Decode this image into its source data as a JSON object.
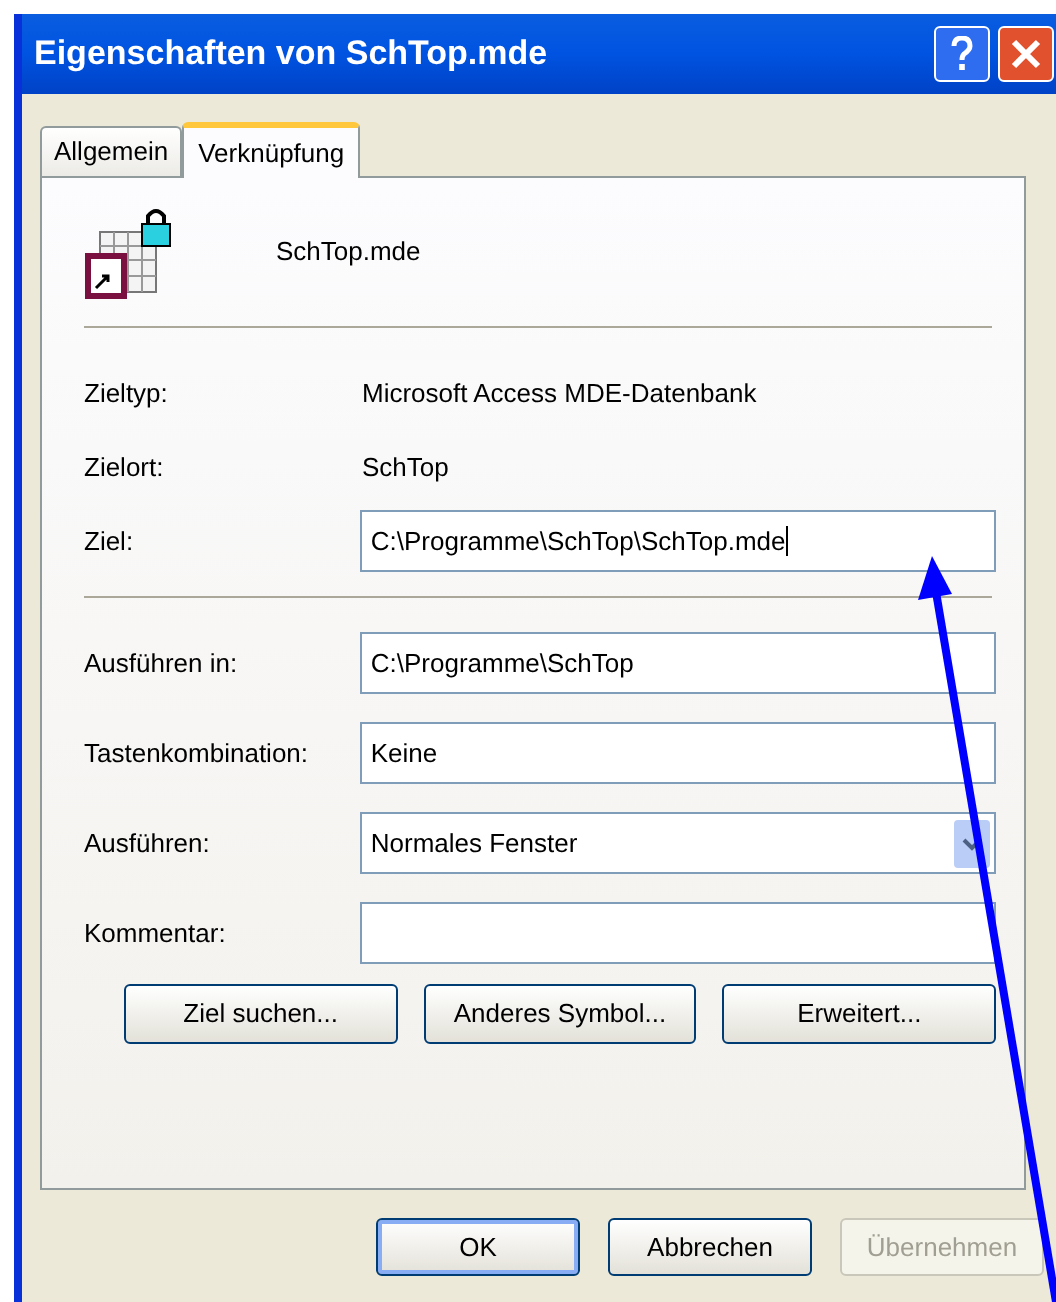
{
  "window": {
    "title": "Eigenschaften von SchTop.mde"
  },
  "tabs": [
    {
      "label": "Allgemein",
      "selected": false
    },
    {
      "label": "Verknüpfung",
      "selected": true
    }
  ],
  "file_name": "SchTop.mde",
  "info": [
    {
      "label": "Zieltyp:",
      "value": "Microsoft Access MDE-Datenbank"
    },
    {
      "label": "Zielort:",
      "value": "SchTop"
    }
  ],
  "target": {
    "label": "Ziel:",
    "value": "C:\\Programme\\SchTop\\SchTop.mde"
  },
  "fields": [
    {
      "kind": "text",
      "label": "Ausführen in:",
      "value": "C:\\Programme\\SchTop"
    },
    {
      "kind": "text",
      "label": "Tastenkombination:",
      "value": "Keine"
    },
    {
      "kind": "combo",
      "label": "Ausführen:",
      "value": "Normales Fenster"
    },
    {
      "kind": "text",
      "label": "Kommentar:"
    }
  ],
  "actions": [
    "Ziel suchen...",
    "Anderes Symbol...",
    "Erweitert..."
  ],
  "dialog_buttons": [
    {
      "label": "OK",
      "default": true,
      "disabled": false
    },
    {
      "label": "Abbrechen",
      "default": false,
      "disabled": false
    },
    {
      "label": "Übernehmen",
      "default": false,
      "disabled": true
    }
  ]
}
